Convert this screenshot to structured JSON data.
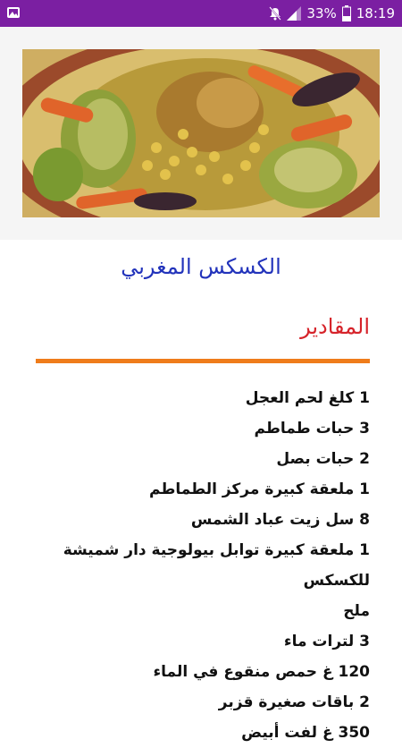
{
  "status_bar": {
    "battery": "33%",
    "time": "18:19",
    "icons": [
      "image-notification-icon",
      "mute-icon",
      "signal-icon",
      "battery-icon"
    ]
  },
  "recipe": {
    "image": "couscous-dish-photo",
    "title": "الكسكس المغربي",
    "ingredients_heading": "المقادير",
    "ingredients": [
      "1 كلغ لحم العجل",
      "3 حبات طماطم",
      "2 حبات بصل",
      "1 ملعقة كبيرة مركز الطماطم",
      "8 سل زيت عباد الشمس",
      "1 ملعقة كبيرة توابل بيولوجية دار شميشة للكسكس",
      "ملح",
      "3 لترات ماء",
      "120 غ حمص منقوع في الماء",
      "2 باقات صغيرة قزبر",
      "350 غ لفت أبيض"
    ]
  },
  "colors": {
    "status_bar": "#7b1fa2",
    "title": "#2233bb",
    "heading": "#d6232a",
    "divider": "#ef7c1b"
  }
}
